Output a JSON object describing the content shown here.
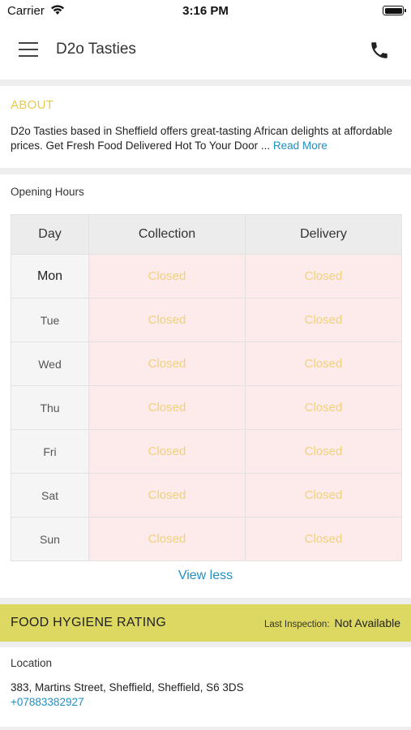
{
  "status_bar": {
    "carrier": "Carrier",
    "time": "3:16 PM",
    "icons": [
      "wifi-icon",
      "battery-icon"
    ]
  },
  "nav": {
    "title": "D2o Tasties",
    "icons": [
      "menu-icon",
      "phone-icon"
    ]
  },
  "about": {
    "heading": "ABOUT",
    "text": "D2o Tasties based in Sheffield offers great-tasting African delights at affordable prices. Get Fresh Food Delivered Hot To Your Door ...",
    "read_more": "Read More"
  },
  "opening_hours": {
    "label": "Opening Hours",
    "headers": [
      "Day",
      "Collection",
      "Delivery"
    ],
    "rows": [
      {
        "day": "Mon",
        "collection": "Closed",
        "delivery": "Closed"
      },
      {
        "day": "Tue",
        "collection": "Closed",
        "delivery": "Closed"
      },
      {
        "day": "Wed",
        "collection": "Closed",
        "delivery": "Closed"
      },
      {
        "day": "Thu",
        "collection": "Closed",
        "delivery": "Closed"
      },
      {
        "day": "Fri",
        "collection": "Closed",
        "delivery": "Closed"
      },
      {
        "day": "Sat",
        "collection": "Closed",
        "delivery": "Closed"
      },
      {
        "day": "Sun",
        "collection": "Closed",
        "delivery": "Closed"
      }
    ],
    "view_less": "View less"
  },
  "hygiene": {
    "title": "FOOD HYGIENE RATING",
    "last_inspection_label": "Last Inspection:",
    "last_inspection_value": "Not Available"
  },
  "location": {
    "label": "Location",
    "address": "383, Martins Street, Sheffield, Sheffield, S6 3DS",
    "phone": "+07883382927"
  },
  "colors": {
    "accent_yellow": "#e8c94a",
    "link_blue": "#1f8fc4",
    "hygiene_bar": "#dcd861",
    "closed_bg": "#fdeaea"
  }
}
